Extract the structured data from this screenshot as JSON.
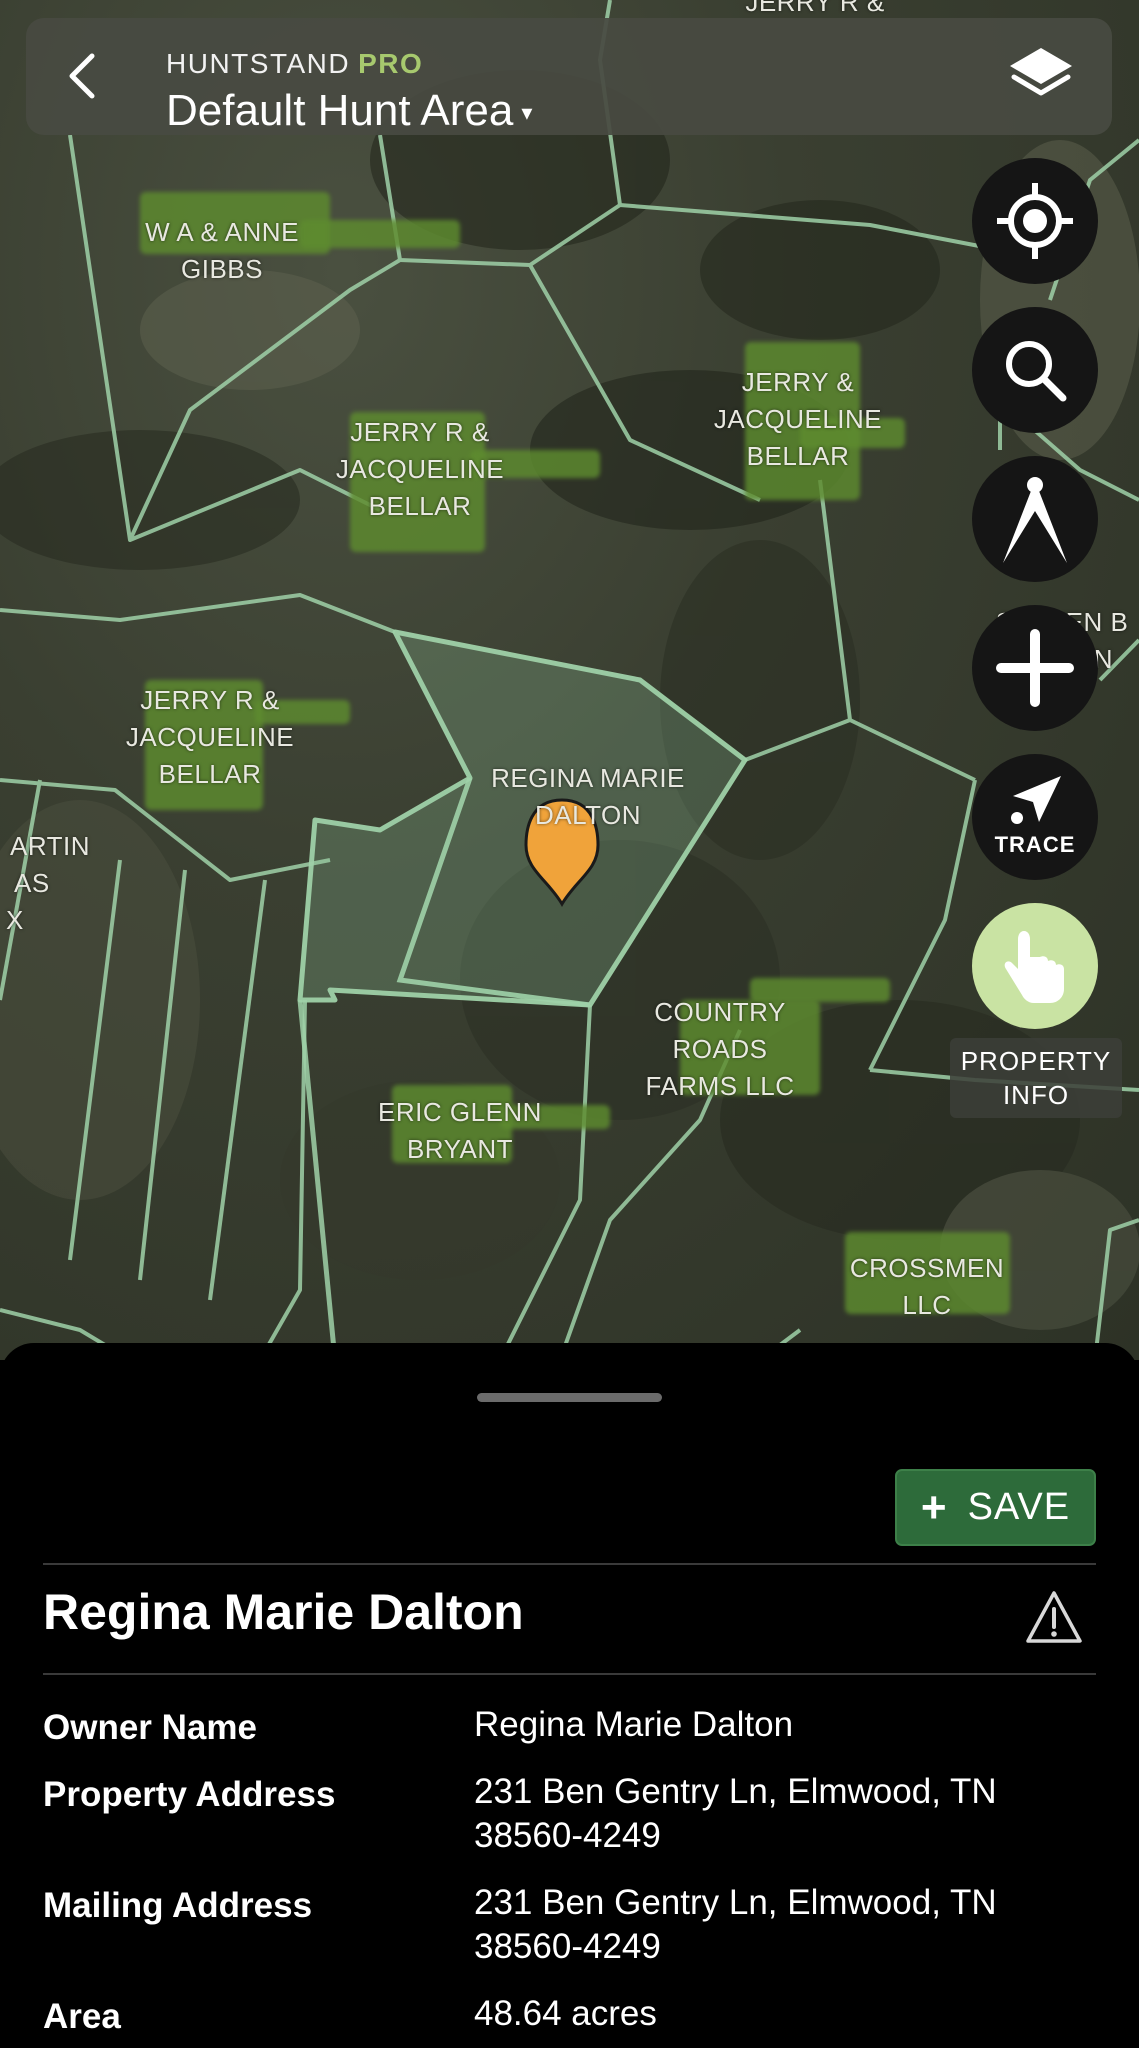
{
  "header": {
    "app_name": "HUNTSTAND",
    "app_tier": "PRO",
    "area_title": "Default Hunt Area",
    "area_caret": "▾",
    "back_icon": "chevron-left-icon",
    "layers_icon": "layers-icon"
  },
  "map": {
    "parcels": [
      {
        "lines": [
          "JERRY R &"
        ]
      },
      {
        "lines": [
          "W A & ANNE",
          "GIBBS"
        ]
      },
      {
        "lines": [
          "JERRY R &",
          "JACQUELINE",
          "BELLAR"
        ]
      },
      {
        "lines": [
          "JERRY &",
          "JACQUELINE",
          "BELLAR"
        ]
      },
      {
        "lines": [
          "JERRY R &",
          "JACQUELINE",
          "BELLAR"
        ]
      },
      {
        "lines": [
          "REGINA MARIE",
          "DALTON"
        ]
      },
      {
        "lines": [
          "ARTIN",
          "AS",
          "X"
        ]
      },
      {
        "lines": [
          "STEVEN B",
          "MARTIN"
        ]
      },
      {
        "lines": [
          "COUNTRY",
          "ROADS",
          "FARMS LLC"
        ]
      },
      {
        "lines": [
          "ERIC GLENN",
          "BRYANT"
        ]
      },
      {
        "lines": [
          "CROSSMEN",
          "LLC"
        ]
      }
    ],
    "pin_color": "#f0a33a",
    "boundary_color": "#9fd1a8",
    "selected_fill": "rgba(140,190,150,0.28)",
    "redaction_color": "#5e8c2f"
  },
  "controls": {
    "locate_icon": "crosshair-icon",
    "search_icon": "search-icon",
    "measure_icon": "compass-icon",
    "add_icon": "plus-icon",
    "trace_icon": "trace-arrow-icon",
    "trace_label": "TRACE",
    "property_icon": "tap-hand-icon",
    "property_label_line1": "PROPERTY",
    "property_label_line2": "INFO",
    "property_button_color": "#c9e3a3"
  },
  "sheet": {
    "save_label": "SAVE",
    "save_color": "#2d6b3a",
    "title": "Regina Marie Dalton",
    "warning_icon": "warning-triangle-icon",
    "rows": [
      {
        "label": "Owner Name",
        "value": "Regina Marie Dalton"
      },
      {
        "label": "Property Address",
        "value_line1": "231 Ben Gentry Ln, Elmwood, TN",
        "value_line2": "38560-4249"
      },
      {
        "label": "Mailing Address",
        "value_line1": "231 Ben Gentry Ln, Elmwood, TN",
        "value_line2": "38560-4249"
      },
      {
        "label": "Area",
        "value": "48.64 acres"
      }
    ]
  }
}
